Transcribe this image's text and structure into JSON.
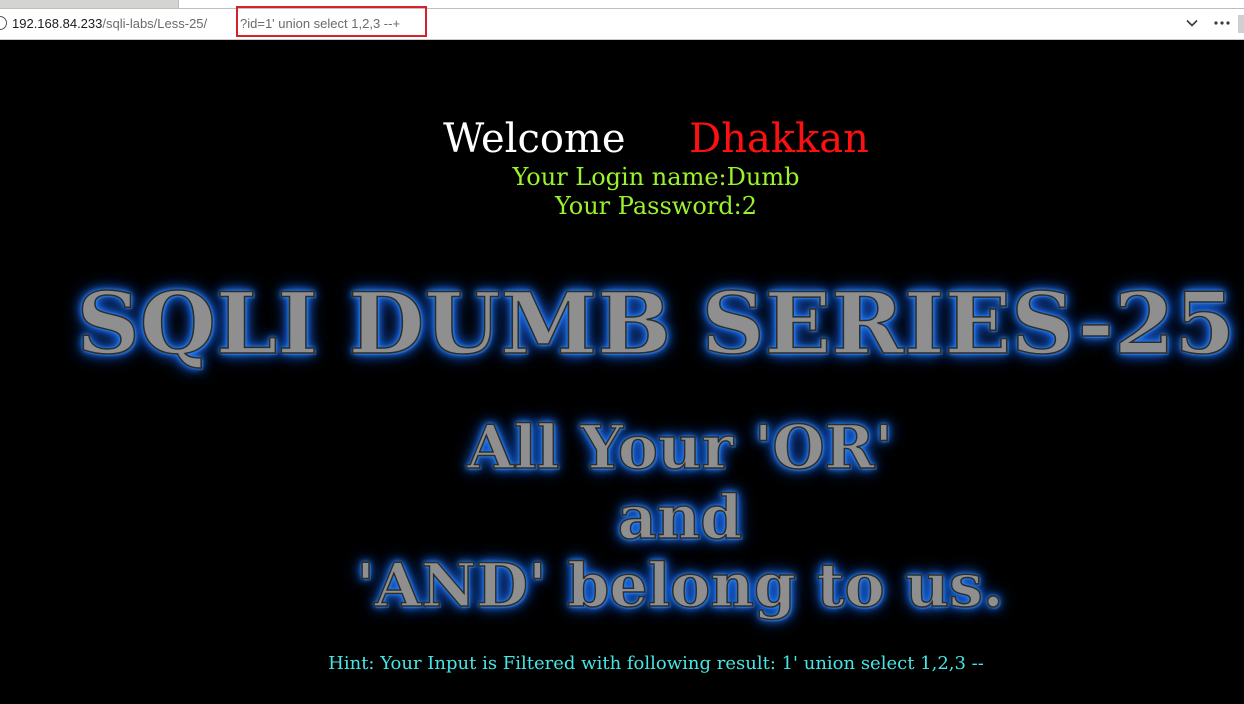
{
  "browser": {
    "url_host": "192.168.84.233",
    "url_path": "/sqli-labs/Less-25/",
    "url_query": "?id=1' union select 1,2,3 --+"
  },
  "page": {
    "welcome_word": "Welcome",
    "welcome_name": "Dhakkan",
    "login_line": "Your Login name:Dumb",
    "password_line": "Your Password:2",
    "banner_title": "SQLI DUMB SERIES-25",
    "banner_lines": [
      "All Your 'OR'",
      "and",
      "'AND' belong to us."
    ],
    "hint": "Hint: Your Input is Filtered with following result: 1' union select 1,2,3 --"
  },
  "colors": {
    "background": "#000000",
    "welcome_word": "#ffffff",
    "welcome_name": "#ff1010",
    "credentials": "#9bf32b",
    "banner_fill": "#8f8f8f",
    "banner_glow": "#1f86ff",
    "hint": "#46e6e6",
    "url_highlight_box": "#d6212c"
  }
}
